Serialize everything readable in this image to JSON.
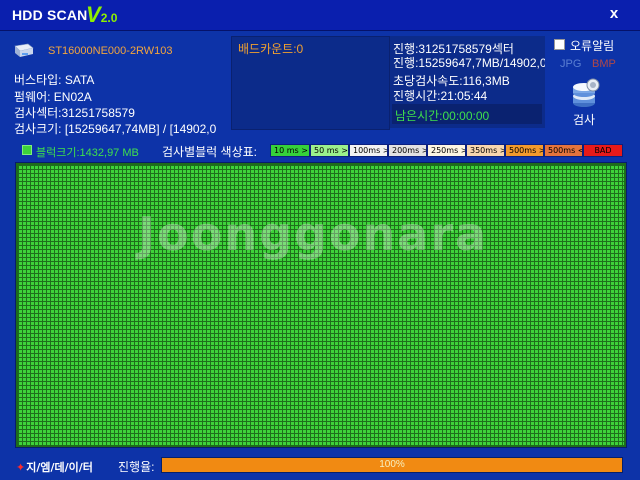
{
  "window": {
    "title": "HDD SCAN",
    "version_prefix": "V",
    "version_number": "2.0",
    "close_label": "x"
  },
  "drive": {
    "icon": "hdd-icon",
    "model": "ST16000NE000-2RW103",
    "bus_type": "버스타입: SATA",
    "firmware": "펌웨어: EN02A",
    "sectors": "검사섹터:31251758579",
    "scan_size": "검사크기: [15259647,74MB] / [14902,0"
  },
  "status": {
    "bad_count": "배드카운트:0",
    "progress_sectors": "진행:31251758579섹터",
    "progress_size": "진행:15259647,7MB/14902,0",
    "speed": "초당검사속도:116,3MB",
    "elapsed": "진행시간:21:05:44",
    "remaining": "남은시간:00:00:00"
  },
  "options": {
    "error_alert_label": "오류알림",
    "error_alert_checked": false,
    "format_jpg": "JPG",
    "format_bmp": "BMP",
    "scan_button_label": "검사",
    "scan_icon": "disk-stack-icon"
  },
  "legend": {
    "block_size": "블럭크기:1432,97 MB",
    "title": "검사별블럭 색상표:",
    "items": [
      {
        "label": "10 ms >",
        "color": "#36d13a"
      },
      {
        "label": "50 ms >",
        "color": "#9cf08c"
      },
      {
        "label": "100ms >",
        "color": "#f2f2f2"
      },
      {
        "label": "200ms >",
        "color": "#e2e2e2"
      },
      {
        "label": "250ms >",
        "color": "#fdf6e2"
      },
      {
        "label": "350ms >",
        "color": "#f7d6ae"
      },
      {
        "label": "500ms >",
        "color": "#f39a2c"
      },
      {
        "label": "500ms <",
        "color": "#e4743c"
      },
      {
        "label": "BAD",
        "color": "#e81a1a"
      }
    ]
  },
  "block_map": {
    "all_blocks_status": "10 ms >",
    "fill_color": "#3ed23a"
  },
  "watermark": "Joonggonara",
  "footer": {
    "brand_star": "✦",
    "brand": "지/엠/데/이/터",
    "progress_label": "진행율:",
    "progress_text": "100%",
    "progress_fraction": 1.0
  }
}
